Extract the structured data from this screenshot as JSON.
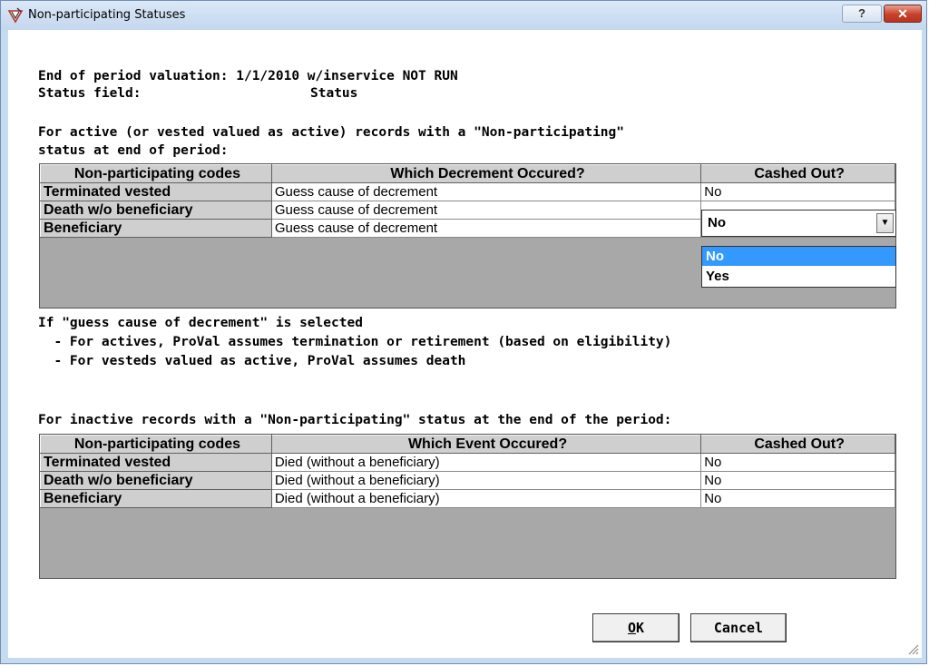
{
  "window": {
    "title": "Non-participating Statuses",
    "help_label": "?",
    "close_label": "✕"
  },
  "info": {
    "valuation_line": "End of period valuation: 1/1/2010 w/inservice NOT RUN",
    "status_field_label": "Status field:",
    "status_field_value": "Status"
  },
  "active_section": {
    "intro_line1": "For active (or vested valued as active) records with a \"Non-participating\"",
    "intro_line2": "status at end of period:",
    "headers": [
      "Non-participating codes",
      "Which Decrement Occured?",
      "Cashed Out?"
    ],
    "rows": [
      {
        "code": "Terminated vested",
        "value": "Guess cause of decrement",
        "cashed": "No"
      },
      {
        "code": "Death w/o beneficiary",
        "value": "Guess cause of decrement",
        "cashed": "No"
      },
      {
        "code": "Beneficiary",
        "value": "Guess cause of decrement",
        "cashed": ""
      }
    ],
    "dropdown": {
      "selected": "No",
      "options": [
        "No",
        "Yes"
      ],
      "highlighted": "No"
    }
  },
  "notes": {
    "line1": "If \"guess cause of decrement\" is selected",
    "line2": "  - For actives, ProVal assumes termination or retirement (based on eligibility)",
    "line3": "  - For vesteds valued as active, ProVal assumes death"
  },
  "inactive_section": {
    "intro": "For inactive records with a \"Non-participating\" status at the end of the period:",
    "headers": [
      "Non-participating codes",
      "Which Event Occured?",
      "Cashed Out?"
    ],
    "rows": [
      {
        "code": "Terminated vested",
        "value": "Died (without a beneficiary)",
        "cashed": "No"
      },
      {
        "code": "Death w/o beneficiary",
        "value": "Died (without a beneficiary)",
        "cashed": "No"
      },
      {
        "code": "Beneficiary",
        "value": "Died (without a beneficiary)",
        "cashed": "No"
      }
    ]
  },
  "buttons": {
    "ok_prefix": "O",
    "ok_rest": "K",
    "cancel": "Cancel"
  },
  "colors": {
    "titlebar": "#c7dbf0",
    "grid_header": "#cfcfcf",
    "grid_empty": "#a8a8a8",
    "selection": "#3399ff",
    "close_button": "#c8402a"
  },
  "icons": {
    "app": "proval-app-icon",
    "dropdown": "chevron-down-icon",
    "resize": "resize-grip-icon"
  }
}
